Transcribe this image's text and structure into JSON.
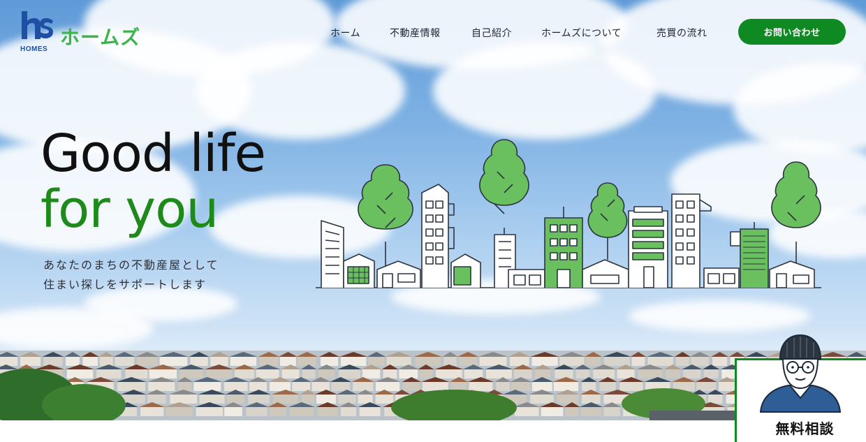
{
  "brand": {
    "mark": "hs",
    "sub": "HOMES",
    "name": "ホームズ",
    "colors": {
      "primary": "#1e4fa3",
      "accent": "#3bb44a"
    }
  },
  "nav": {
    "items": [
      {
        "label": "ホーム"
      },
      {
        "label": "不動産情報"
      },
      {
        "label": "自己紹介"
      },
      {
        "label": "ホームズについて"
      },
      {
        "label": "売買の流れ"
      }
    ],
    "cta_label": "お問い合わせ",
    "cta_color": "#0f8a22"
  },
  "hero": {
    "title_line1": "Good life",
    "title_line2": "for you",
    "title_line2_color": "#1e8a19",
    "subtitle_line1": "あなたのまちの不動産屋として",
    "subtitle_line2": "住まい探しをサポートします",
    "illustration": "city-skyline-with-trees-icon"
  },
  "consult": {
    "label": "無料相談",
    "avatar": "man-with-glasses-beanie-avatar"
  }
}
